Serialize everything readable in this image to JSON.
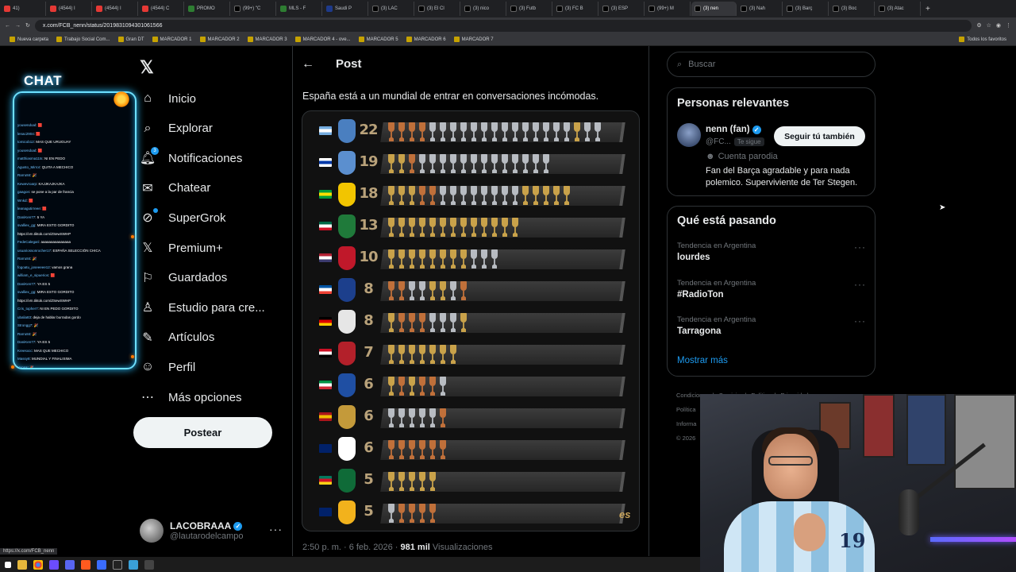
{
  "browser": {
    "tabs": [
      {
        "label": "41)",
        "fav": "red"
      },
      {
        "label": "(4544) I",
        "fav": "red"
      },
      {
        "label": "(4544) I",
        "fav": "red"
      },
      {
        "label": "(4544) C",
        "fav": "red"
      },
      {
        "label": "PROMO",
        "fav": "g"
      },
      {
        "label": "(99+) \"C",
        "fav": "x"
      },
      {
        "label": "MLS - F",
        "fav": "g"
      },
      {
        "label": "Saudi P",
        "fav": "b"
      },
      {
        "label": "(3) LAC",
        "fav": "x"
      },
      {
        "label": "(3) El Cl",
        "fav": "x"
      },
      {
        "label": "(3) nico",
        "fav": "x"
      },
      {
        "label": "(3) Futb",
        "fav": "x"
      },
      {
        "label": "(3) FC B",
        "fav": "x"
      },
      {
        "label": "(3) ESP",
        "fav": "x"
      },
      {
        "label": "(99+) M",
        "fav": "x"
      },
      {
        "label": "(3) nen",
        "fav": "x",
        "active": true
      },
      {
        "label": "(3) Nah",
        "fav": "x"
      },
      {
        "label": "(3) Barç",
        "fav": "x"
      },
      {
        "label": "(3) Boc",
        "fav": "x"
      },
      {
        "label": "(3) Atac",
        "fav": "x"
      }
    ],
    "url": "x.com/FCB_nenn/status/2019831094301061566",
    "bookmarks": [
      "Nueva carpeta",
      "Trabajo Social Com...",
      "Gran DT",
      "MARCADOR 1",
      "MARCADOR 2",
      "MARCADOR 3",
      "MARCADOR 4 - ove...",
      "MARCADOR 5",
      "MARCADOR 6",
      "MARCADOR 7"
    ],
    "all_bookmarks": "Todos los favoritos",
    "status_url": "https://x.com/FCB_nenn"
  },
  "chat": {
    "title": "CHAT",
    "lines": [
      {
        "user": "yousendoal",
        "msg": ": 🟥"
      },
      {
        "user": "lenac2904",
        "msg": ": 🟥"
      },
      {
        "user": "tomicob12",
        "msg": ": MAS QUE URUGUAY"
      },
      {
        "user": "yousendoal",
        "msg": ": 🟥"
      },
      {
        "user": "matthiasma11ts",
        "msg": ": NI EN PEDO"
      },
      {
        "user": "Agusto_Mirror",
        "msg": ": QUITA A MECHICO"
      },
      {
        "user": "Rarru84",
        "msg": ": 🎉"
      },
      {
        "user": "Kewevroarp",
        "msg": ": KAJJKAJKAJKA"
      },
      {
        "user": "gaagon",
        "msg": ": se pone a la par de francia"
      },
      {
        "user": "Wnkd",
        "msg": ": 🟥"
      },
      {
        "user": "leanagutirreee",
        "msg": ": 🟥"
      },
      {
        "user": "DaniKen77",
        "msg": ": 5 YA"
      },
      {
        "user": "svalliex_gg",
        "msg": ": MIRA ESTO GORDITO"
      },
      {
        "user": "",
        "msg": "https://vm.tiktok.com/ZSewSWHP"
      },
      {
        "user": "FedeCalegari",
        "msg": ": aaaaaaaaaaaaaaa"
      },
      {
        "user": "usuariossonrocher17",
        "msg": ": ESPAÑA SELECCIÓN CHICA"
      },
      {
        "user": "Rarru84",
        "msg": ": 🎉"
      },
      {
        "user": "fogoatu_joseeeee12",
        "msg": ": vamos grana"
      },
      {
        "user": "william_e_sipuerios",
        "msg": ": 🟥"
      },
      {
        "user": "DaniKen77",
        "msg": ": YA ES 5"
      },
      {
        "user": "svalliex_gg",
        "msg": ": MIRA ESTO GORDITO"
      },
      {
        "user": "",
        "msg": "https://vm.tiktok.com/ZSewSWHP"
      },
      {
        "user": "Cris_topher7",
        "msg": ": NI EN PEDO GORDITO"
      },
      {
        "user": "ubalia83",
        "msg": ": deja de hablar burradas gordo"
      },
      {
        "user": "Strongg7",
        "msg": ": 🎉"
      },
      {
        "user": "Rarru84",
        "msg": ": 🎉"
      },
      {
        "user": "DaniKen77",
        "msg": ": YA ES 5"
      },
      {
        "user": "Kreesxcc",
        "msg": ": MAS QUE MECHICO"
      },
      {
        "user": "Massy8",
        "msg": ": MUNDIAL Y FINALISIMA"
      },
      {
        "user": "Yunsa",
        "msg": ": 🎉"
      },
      {
        "user": "jp_TR_xd",
        "msg": ": 🟥"
      }
    ]
  },
  "nav": {
    "items": [
      {
        "label": "Inicio",
        "icon": "home-icon",
        "glyph": "⌂"
      },
      {
        "label": "Explorar",
        "icon": "search-icon",
        "glyph": "⌕"
      },
      {
        "label": "Notificaciones",
        "icon": "bell-icon",
        "glyph": "🔔︎",
        "badge": "3"
      },
      {
        "label": "Chatear",
        "icon": "mail-icon",
        "glyph": "✉"
      },
      {
        "label": "SuperGrok",
        "icon": "grok-icon",
        "glyph": "⊘",
        "dot": true
      },
      {
        "label": "Premium+",
        "icon": "x-premium-icon",
        "glyph": "𝕏"
      },
      {
        "label": "Guardados",
        "icon": "bookmark-icon",
        "glyph": "⚐"
      },
      {
        "label": "Estudio para cre...",
        "icon": "creator-studio-icon",
        "glyph": "♙"
      },
      {
        "label": "Artículos",
        "icon": "article-icon",
        "glyph": "✎"
      },
      {
        "label": "Perfil",
        "icon": "profile-icon",
        "glyph": "☺"
      },
      {
        "label": "Más opciones",
        "icon": "more-options-icon",
        "glyph": "⋯"
      }
    ],
    "post_button": "Postear",
    "account": {
      "name": "LACOBRAAA",
      "handle": "@lautarodelcampo"
    }
  },
  "post": {
    "header": "Post",
    "text": "España está a un mundial de entrar en conversaciones incómodas.",
    "watermark": "es",
    "time": "2:50 p. m. · 6 feb. 2026 · ",
    "views_count": "981 mil",
    "views_label": " Visualizaciones",
    "graphic_rows": [
      {
        "team": "Argentina",
        "count": "22",
        "flag": [
          "#74acdf",
          "#ffffff",
          "#74acdf"
        ],
        "crest": "#4a7fc0",
        "trophies": [
          "b",
          "b",
          "b",
          "b",
          "s",
          "s",
          "s",
          "s",
          "s",
          "s",
          "s",
          "s",
          "s",
          "s",
          "s",
          "s",
          "s",
          "s",
          "g",
          "s",
          "s"
        ]
      },
      {
        "team": "Uruguay",
        "count": "19",
        "flag": [
          "#ffffff",
          "#0038a8",
          "#ffffff"
        ],
        "crest": "#5b8fcf",
        "trophies": [
          "g",
          "g",
          "b",
          "s",
          "s",
          "s",
          "s",
          "s",
          "s",
          "s",
          "s",
          "s",
          "s",
          "s",
          "s",
          "s"
        ]
      },
      {
        "team": "Brasil",
        "count": "18",
        "flag": [
          "#009c3b",
          "#ffdf00",
          "#009c3b"
        ],
        "crest": "#f2c500",
        "trophies": [
          "g",
          "g",
          "g",
          "b",
          "b",
          "s",
          "s",
          "s",
          "s",
          "s",
          "s",
          "s",
          "s",
          "g",
          "g",
          "g",
          "g",
          "g"
        ]
      },
      {
        "team": "México",
        "count": "13",
        "flag": [
          "#006847",
          "#ffffff",
          "#ce1126"
        ],
        "crest": "#1f7a3a",
        "trophies": [
          "g",
          "g",
          "g",
          "g",
          "g",
          "g",
          "g",
          "g",
          "g",
          "g",
          "g",
          "g",
          "g"
        ]
      },
      {
        "team": "Estados Unidos",
        "count": "10",
        "flag": [
          "#b22234",
          "#ffffff",
          "#3c3b6e"
        ],
        "crest": "#c0182a",
        "trophies": [
          "g",
          "g",
          "g",
          "g",
          "g",
          "g",
          "g",
          "g",
          "s",
          "s",
          "s"
        ]
      },
      {
        "team": "Francia",
        "count": "8",
        "flag": [
          "#0055a4",
          "#ffffff",
          "#ef4135"
        ],
        "crest": "#1c3f8c",
        "trophies": [
          "b",
          "b",
          "s",
          "s",
          "g",
          "g",
          "s",
          "b"
        ]
      },
      {
        "team": "Alemania",
        "count": "8",
        "flag": [
          "#000000",
          "#dd0000",
          "#ffce00"
        ],
        "crest": "#e6e6e6",
        "trophies": [
          "g",
          "b",
          "b",
          "b",
          "s",
          "s",
          "s",
          "g"
        ]
      },
      {
        "team": "Egipto",
        "count": "7",
        "flag": [
          "#ce1126",
          "#ffffff",
          "#000000"
        ],
        "crest": "#b3202a",
        "trophies": [
          "g",
          "g",
          "g",
          "g",
          "g",
          "g",
          "g"
        ]
      },
      {
        "team": "Italia",
        "count": "6",
        "flag": [
          "#009246",
          "#ffffff",
          "#ce2b37"
        ],
        "crest": "#1f4fa3",
        "trophies": [
          "g",
          "b",
          "g",
          "b",
          "b",
          "s"
        ]
      },
      {
        "team": "España",
        "count": "6",
        "flag": [
          "#aa151b",
          "#f1bf00",
          "#aa151b"
        ],
        "crest": "#c49a3a",
        "trophies": [
          "s",
          "s",
          "s",
          "s",
          "s",
          "b"
        ]
      },
      {
        "team": "Nueva Zelanda",
        "count": "6",
        "flag": [
          "#012169",
          "#012169",
          "#012169"
        ],
        "crest": "#ffffff",
        "trophies": [
          "b",
          "b",
          "b",
          "b",
          "b",
          "b"
        ]
      },
      {
        "team": "Camerún",
        "count": "5",
        "flag": [
          "#007a5e",
          "#ce1126",
          "#fcd116"
        ],
        "crest": "#0f6b38",
        "trophies": [
          "g",
          "g",
          "g",
          "g",
          "g"
        ]
      },
      {
        "team": "Australia",
        "count": "5",
        "flag": [
          "#012169",
          "#012169",
          "#012169"
        ],
        "crest": "#f2b21c",
        "trophies": [
          "s",
          "b",
          "b",
          "b",
          "b"
        ]
      }
    ],
    "trophy_colors": {
      "g": "#c9a24a",
      "s": "#b8bcc2",
      "b": "#c0703a"
    }
  },
  "right": {
    "search_placeholder": "Buscar",
    "relevant": {
      "title": "Personas relevantes",
      "name": "nenn (fan)",
      "handle": "@FC...",
      "follows_you": "Te sigue",
      "follow_button": "Seguir tú también",
      "parody": "Cuenta parodia",
      "bio": "Fan del Barça agradable y para nada polemico. Superviviente de Ter Stegen."
    },
    "trends": {
      "title": "Qué está pasando",
      "items": [
        {
          "meta": "Tendencia en Argentina",
          "name": "lourdes"
        },
        {
          "meta": "Tendencia en Argentina",
          "name": "#RadioTon"
        },
        {
          "meta": "Tendencia en Argentina",
          "name": "Tarragona"
        }
      ],
      "show_more": "Mostrar más"
    },
    "footer": [
      "Condiciones de Servicio",
      "|",
      "Política de Privacidad",
      "Política",
      "Informa",
      "© 2026"
    ]
  },
  "colors": {
    "accent": "#1d9bf0",
    "background": "#000000",
    "text": "#e7e9ea",
    "muted": "#71767b"
  }
}
